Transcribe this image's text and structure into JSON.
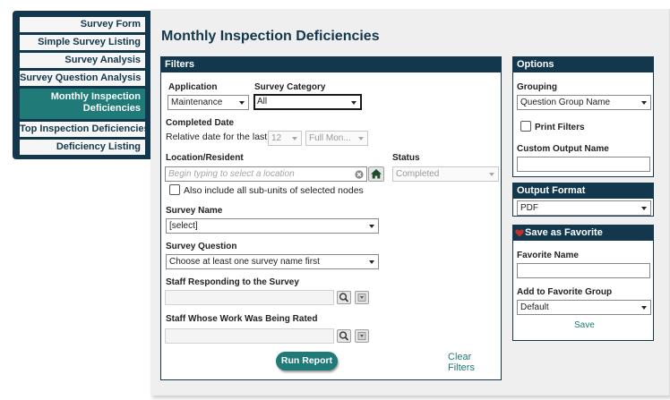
{
  "page_title": "Monthly Inspection Deficiencies",
  "sidebar": {
    "items": [
      {
        "label": "Survey Form"
      },
      {
        "label": "Simple Survey Listing"
      },
      {
        "label": "Survey Analysis"
      },
      {
        "label": "Survey Question Analysis"
      },
      {
        "label": "Monthly Inspection Deficiencies",
        "active": true
      },
      {
        "label": "Top Inspection Deficiencies"
      },
      {
        "label": "Deficiency Listing"
      }
    ]
  },
  "filters": {
    "header": "Filters",
    "application_label": "Application",
    "application_value": "Maintenance",
    "survey_category_label": "Survey Category",
    "survey_category_value": "All",
    "completed_date_label": "Completed Date",
    "relative_date_text": "Relative date for the last",
    "relative_count": "12",
    "relative_unit": "Full Mon...",
    "location_label": "Location/Resident",
    "location_placeholder": "Begin typing to select a location",
    "status_label": "Status",
    "status_value": "Completed",
    "subunits_text": "Also include all sub-units of selected nodes",
    "survey_name_label": "Survey Name",
    "survey_name_value": "[select]",
    "survey_question_label": "Survey Question",
    "survey_question_value": "Choose at least one survey name first",
    "staff_responding_label": "Staff Responding to the Survey",
    "staff_rated_label": "Staff Whose Work Was Being Rated",
    "run_button": "Run Report",
    "clear_link": "Clear Filters"
  },
  "options": {
    "header": "Options",
    "grouping_label": "Grouping",
    "grouping_value": "Question Group Name",
    "print_filters_label": "Print Filters",
    "custom_output_label": "Custom Output Name"
  },
  "output_format": {
    "header": "Output Format",
    "value": "PDF"
  },
  "favorite": {
    "header": "Save as Favorite",
    "favorite_name_label": "Favorite Name",
    "group_label": "Add to Favorite Group",
    "group_value": "Default",
    "save_link": "Save"
  },
  "colors": {
    "navy": "#13384d",
    "teal": "#1f7a78",
    "heart": "#c0302e"
  }
}
